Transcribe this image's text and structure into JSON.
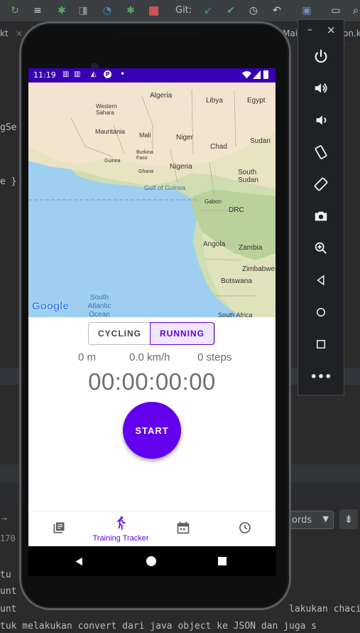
{
  "ide": {
    "toolbar": {
      "git_label": "Git:"
    },
    "tabs": [
      {
        "label": "kt"
      },
      {
        "label": "Main"
      },
      {
        "label": "on.kt"
      }
    ],
    "code_fragments": {
      "left_1": "gSe",
      "left_2": "e }",
      "left_3": "170",
      "left_4": "tu",
      "left_5": "unt",
      "bottom_1": "unt",
      "bottom_1_right": "lakukan chaci",
      "bottom_2": "tuk melakukan convert dari java object ke JSON dan juga s"
    },
    "words_dropdown": {
      "label": "ords"
    }
  },
  "emulator_panel": {
    "buttons": [
      {
        "name": "minimize",
        "glyph": "–"
      },
      {
        "name": "close",
        "glyph": "×"
      }
    ]
  },
  "status_bar": {
    "time": "11:19",
    "background": "#3700b3"
  },
  "map": {
    "attribution": "Google",
    "labels": [
      "Algeria",
      "Libya",
      "Egypt",
      "Western Sahara",
      "Mauritania",
      "Mali",
      "Niger",
      "Chad",
      "Sudan",
      "Burkina Faso",
      "Guinea",
      "Ghana",
      "Nigeria",
      "South Sudan",
      "Gulf of Guinea",
      "Gabon",
      "DRC",
      "Angola",
      "Zambia",
      "Zimbabwe",
      "Botswana",
      "South Atlantic Ocean",
      "South Africa"
    ]
  },
  "activity_toggle": {
    "options": [
      "CYCLING",
      "RUNNING"
    ],
    "selected": "RUNNING",
    "accent": "#6200ee"
  },
  "stats": {
    "distance": "0 m",
    "speed": "0.0 km/h",
    "steps": "0 steps"
  },
  "timer": "00:00:00:00",
  "start_button": {
    "label": "START",
    "color": "#6200ee"
  },
  "bottom_nav": {
    "items": [
      {
        "icon": "list-icon",
        "label": ""
      },
      {
        "icon": "running-icon",
        "label": "Training Tracker",
        "active": true
      },
      {
        "icon": "calendar-icon",
        "label": ""
      },
      {
        "icon": "clock-icon",
        "label": ""
      }
    ]
  }
}
